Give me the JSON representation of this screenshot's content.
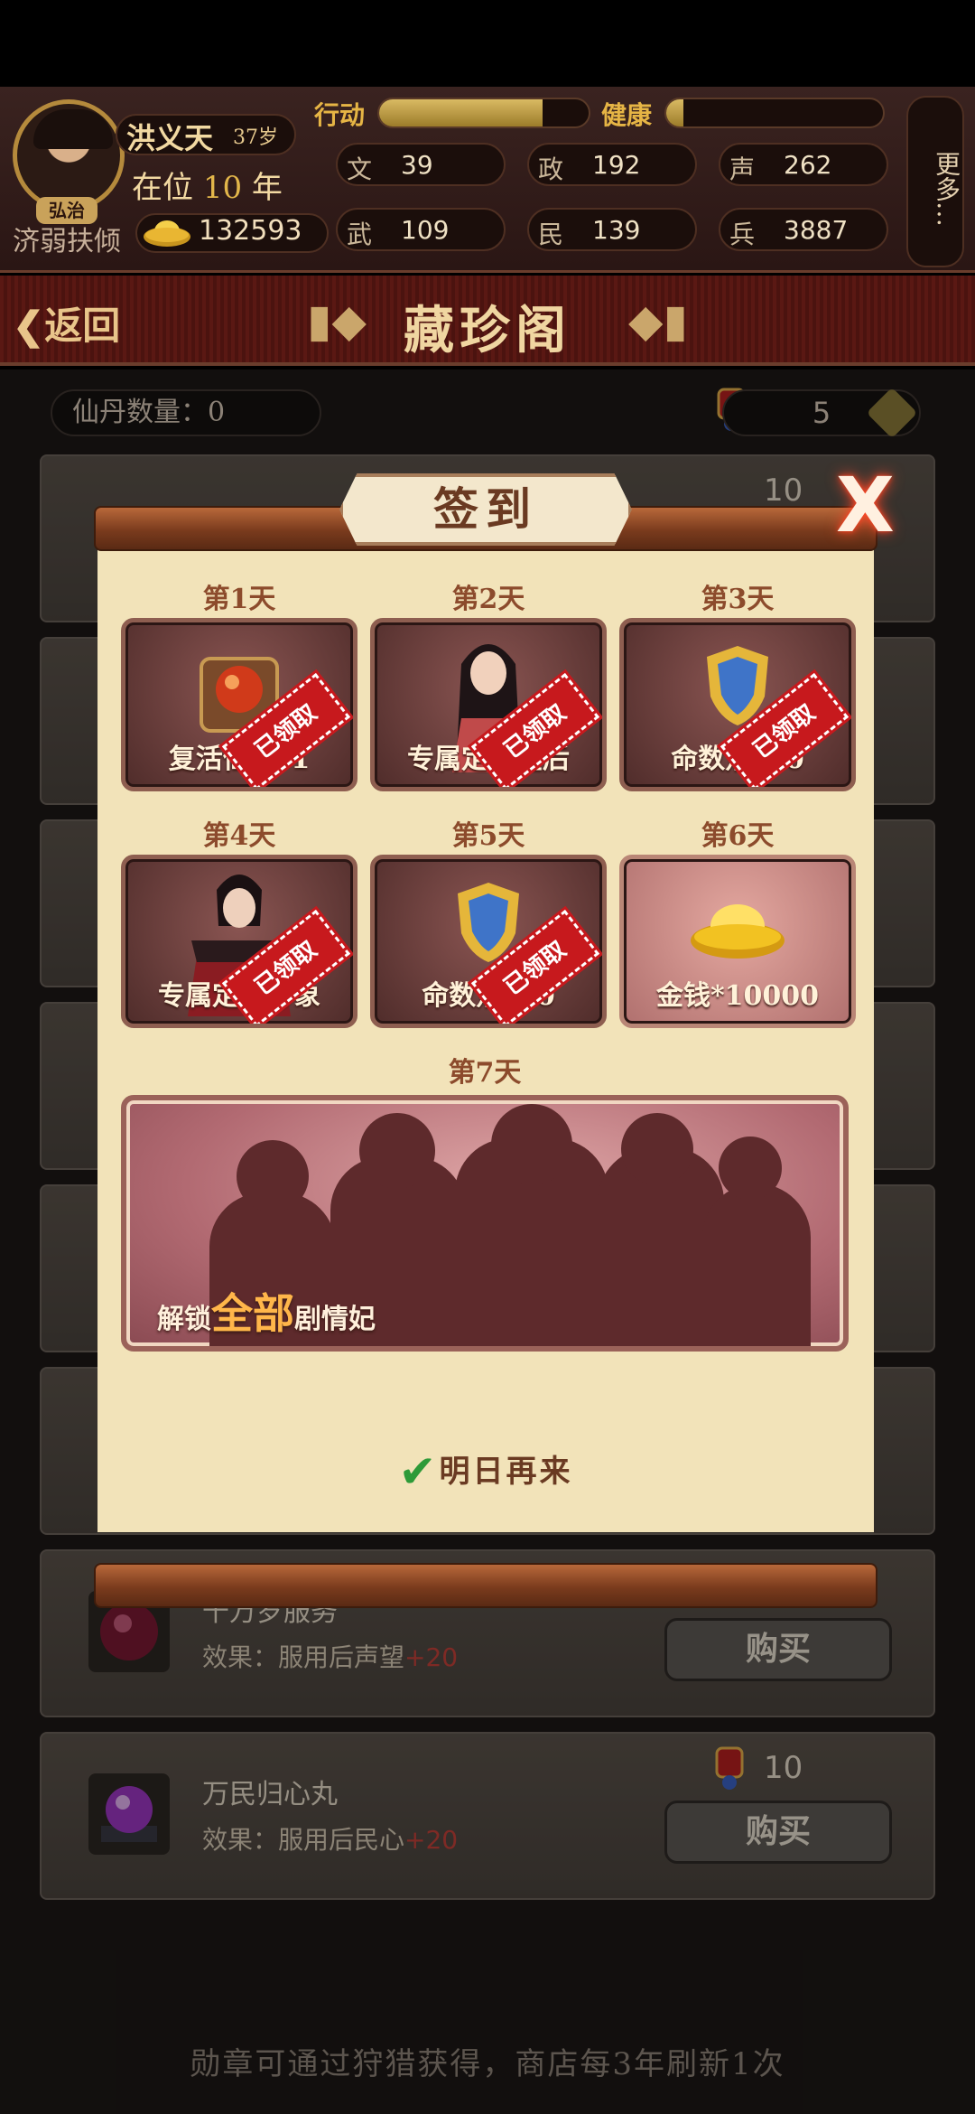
{
  "player": {
    "name": "洪义天",
    "age": "37岁",
    "reign_prefix": "在位",
    "reign_years": "10",
    "reign_suffix": "年",
    "title_badge": "弘治",
    "rank": "济弱扶倾",
    "gold": "132593"
  },
  "bars": {
    "action_label": "行动",
    "action_level": 0.78,
    "health_label": "健康",
    "health_level": 0.08
  },
  "stats": [
    {
      "key": "文",
      "value": "39"
    },
    {
      "key": "政",
      "value": "192"
    },
    {
      "key": "声",
      "value": "262"
    },
    {
      "key": "武",
      "value": "109"
    },
    {
      "key": "民",
      "value": "139"
    },
    {
      "key": "兵",
      "value": "3887"
    }
  ],
  "more_label": "更多…",
  "nav": {
    "back_label": "返回",
    "title": "藏珍阁"
  },
  "shop": {
    "pill_label": "仙丹数量：0",
    "medal_count": "5",
    "items": [
      {
        "name": "",
        "effect_prefix": "",
        "effect_value": "",
        "price": "10",
        "buy_label": ""
      },
      {
        "name": "千万岁服务",
        "effect_prefix": "效果：服用后声望",
        "effect_value": "+20",
        "price": "",
        "buy_label": "购买"
      },
      {
        "name": "万民归心丸",
        "effect_prefix": "效果：服用后民心",
        "effect_value": "+20",
        "price": "10",
        "buy_label": "购买"
      }
    ],
    "footer": "勋章可通过狩猎获得，商店每3年刷新1次"
  },
  "signin": {
    "title": "签到",
    "close_label": "X",
    "days": [
      {
        "day": "第1天",
        "label": "复活仙丹*1",
        "claimed": true
      },
      {
        "day": "第2天",
        "label": "专属定情皇后",
        "claimed": true
      },
      {
        "day": "第3天",
        "label": "命数点*10",
        "claimed": true
      },
      {
        "day": "第4天",
        "label": "专属定情形象",
        "claimed": true
      },
      {
        "day": "第5天",
        "label": "命数点*10",
        "claimed": true
      },
      {
        "day": "第6天",
        "label": "金钱*10000",
        "claimed": false
      }
    ],
    "stamp_label": "已领取",
    "day7": {
      "day": "第7天",
      "prefix": "解锁",
      "highlight": "全部",
      "suffix": "剧情妃"
    },
    "tomorrow_label": "明日再来"
  },
  "colors": {
    "accent_gold": "#e2b64a",
    "stamp_red": "#c7191d",
    "effect_red": "#c2413a",
    "check_green": "#2e9a38"
  }
}
